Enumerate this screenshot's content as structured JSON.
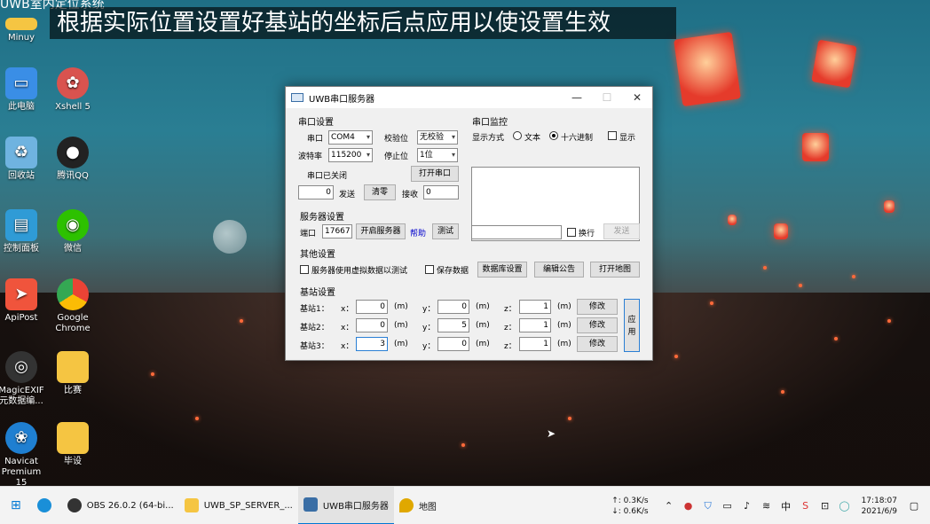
{
  "top_text": "UWB室内定位系统",
  "caption": "根据实际位置设置好基站的坐标后点应用以使设置生效",
  "desktop_icons": [
    {
      "label": "Minuy",
      "icon": "folder-icon",
      "color": "#f5c542"
    },
    {
      "label": "此电脑",
      "icon": "computer-icon",
      "color": "#3a8ee6"
    },
    {
      "label": "Xshell 5",
      "icon": "xshell-icon",
      "color": "#d9534f"
    },
    {
      "label": "回收站",
      "icon": "recycle-bin-icon",
      "color": "#6fb3e0"
    },
    {
      "label": "腾讯QQ",
      "icon": "qq-icon",
      "color": "#222222"
    },
    {
      "label": "控制面板",
      "icon": "control-panel-icon",
      "color": "#2f9bd6"
    },
    {
      "label": "微信",
      "icon": "wechat-icon",
      "color": "#2dc100"
    },
    {
      "label": "ApiPost",
      "icon": "apipost-icon",
      "color": "#f0543c"
    },
    {
      "label": "Google Chrome",
      "icon": "chrome-icon",
      "color": "#34a853"
    },
    {
      "label": "MagicEXIF 元数据编...",
      "icon": "magicexif-icon",
      "color": "#333333"
    },
    {
      "label": "比赛",
      "icon": "folder-icon",
      "color": "#f5c542"
    },
    {
      "label": "Navicat Premium 15",
      "icon": "navicat-icon",
      "color": "#1f7fd1"
    },
    {
      "label": "毕设",
      "icon": "folder-icon",
      "color": "#f5c542"
    }
  ],
  "window": {
    "title": "UWB串口服务器",
    "controls": {
      "minimize": "—",
      "maximize": "☐",
      "close": "✕"
    },
    "serial": {
      "section": "串口设置",
      "port_label": "串口",
      "port_value": "COM4",
      "parity_label": "校验位",
      "parity_value": "无校验",
      "baud_label": "波特率",
      "baud_value": "115200",
      "stop_label": "停止位",
      "stop_value": "1位",
      "status": "串口已关闭",
      "open_button": "打开串口",
      "sent_count": "0",
      "sent_label": "发送",
      "clear_button": "清零",
      "recv_label": "接收",
      "recv_count": "0"
    },
    "monitor": {
      "section": "串口监控",
      "mode_label": "显示方式",
      "text_option": "文本",
      "hex_option": "十六进制",
      "show_label": "显示",
      "newline_label": "换行",
      "send_button": "发送",
      "input_value": ""
    },
    "server": {
      "section": "服务器设置",
      "port_label": "端口",
      "port_value": "17667",
      "start_button": "开启服务器",
      "help_link": "帮助",
      "test_button": "测试"
    },
    "other": {
      "section": "其他设置",
      "virtual_data_label": "服务器使用虚拟数据以测试",
      "save_data_label": "保存数据",
      "db_button": "数据库设置",
      "notice_button": "编辑公告",
      "map_button": "打开地图"
    },
    "stations": {
      "section": "基站设置",
      "rows": [
        {
          "label": "基站1：",
          "x": "0",
          "y": "0",
          "z": "1",
          "button": "修改"
        },
        {
          "label": "基站2：",
          "x": "0",
          "y": "5",
          "z": "1",
          "button": "修改"
        },
        {
          "label": "基站3：",
          "x": "3",
          "y": "0",
          "z": "1",
          "button": "修改"
        }
      ],
      "x_label": "x：",
      "y_label": "y：",
      "z_label": "z：",
      "unit": "(m)",
      "apply_button": "应用"
    }
  },
  "taskbar": {
    "items": [
      {
        "label": "OBS 26.0.2 (64-bi...",
        "color": "#333333"
      },
      {
        "label": "UWB_SP_SERVER_...",
        "color": "#f5c542"
      },
      {
        "label": "UWB串口服务器",
        "color": "#3a6ea5"
      },
      {
        "label": "地图",
        "color": "#e0a800"
      }
    ],
    "net_up": "↑: 0.3K/s",
    "net_down": "↓: 0.6K/s",
    "time": "17:18:07",
    "date": "2021/6/9"
  }
}
